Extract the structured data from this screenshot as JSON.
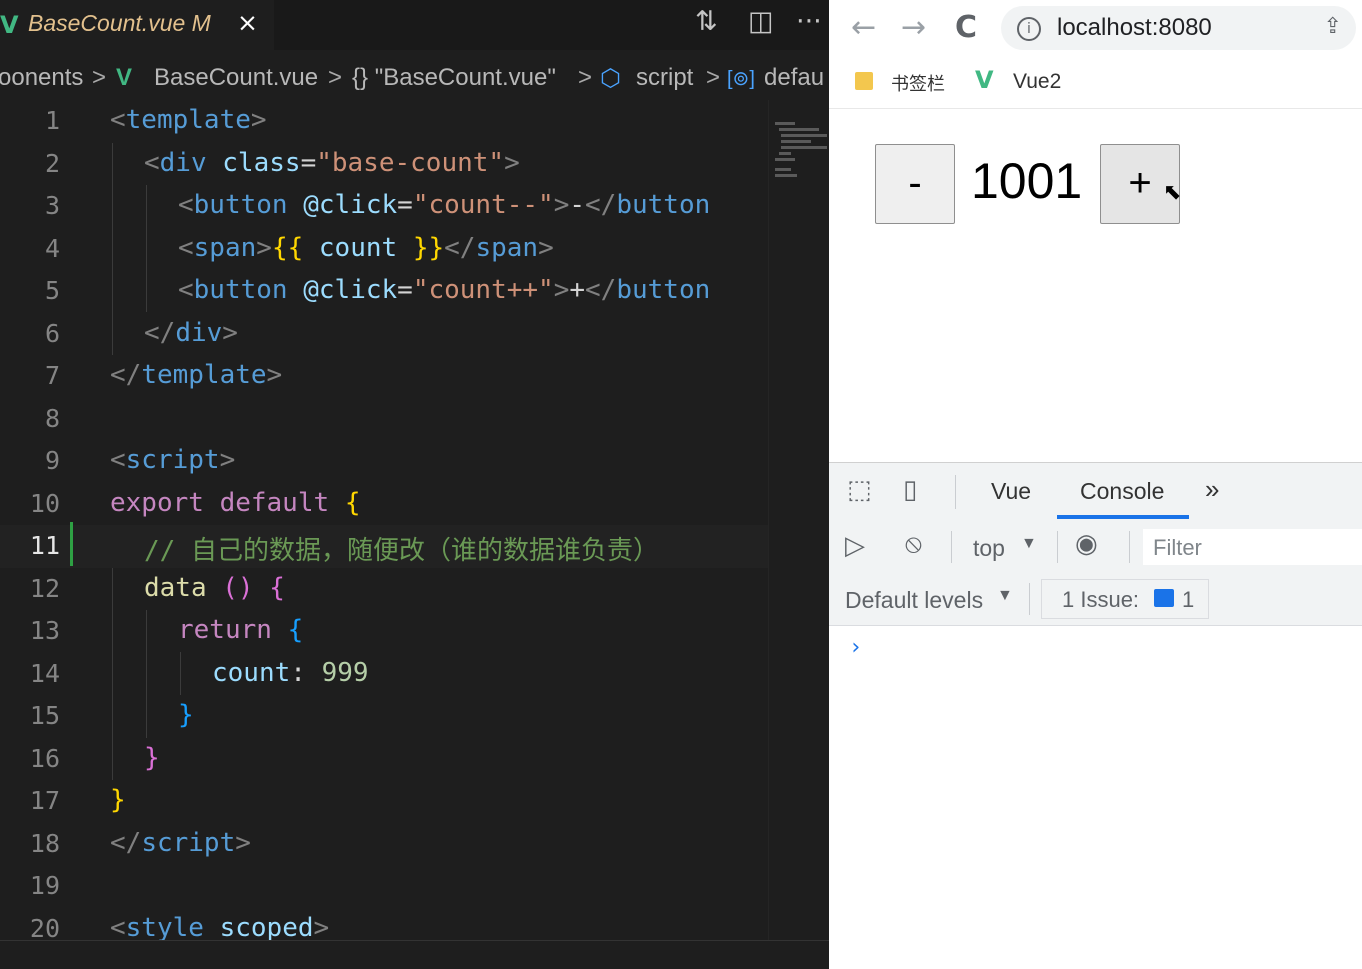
{
  "editor": {
    "tab": {
      "title": "BaseCount.vue  M",
      "close": "×",
      "logo": "V"
    },
    "toolbar_icons": [
      "compare-changes-icon",
      "split-editor-icon",
      "more-actions-icon"
    ],
    "toolbar_glyphs": {
      "compare": "⇅",
      "split": "◫",
      "more": "···"
    },
    "breadcrumb": {
      "items": [
        "oonents",
        "BaseCount.vue",
        "{} \"BaseCount.vue\"",
        "script",
        "defau"
      ],
      "separator": ">",
      "vue_logo": "V",
      "script_glyph": "⬡",
      "default_glyph": "[⊚]"
    },
    "active_line": 11,
    "line_numbers": [
      "1",
      "2",
      "3",
      "4",
      "5",
      "6",
      "7",
      "8",
      "9",
      "10",
      "11",
      "12",
      "13",
      "14",
      "15",
      "16",
      "17",
      "18",
      "19",
      "20"
    ],
    "code": {
      "l1": {
        "lt": "<",
        "tag": "template",
        "gt": ">"
      },
      "l2": {
        "lt": "<",
        "tag": "div",
        "attr": "class",
        "eq": "=",
        "val": "\"base-count\"",
        "gt": ">"
      },
      "l3": {
        "lt": "<",
        "tag": "button",
        "attr": "@click",
        "eq": "=",
        "val": "\"count--\"",
        "gt": ">",
        "text": "-",
        "close": "</",
        "ctag": "button"
      },
      "l4": {
        "lt": "<",
        "tag": "span",
        "gt": ">",
        "open": "{{",
        "expr": " count ",
        "end": "}}",
        "close": "</",
        "ctag": "span",
        "cgt": ">"
      },
      "l5": {
        "lt": "<",
        "tag": "button",
        "attr": "@click",
        "eq": "=",
        "val": "\"count++\"",
        "gt": ">",
        "text": "+",
        "close": "</",
        "ctag": "button"
      },
      "l6": {
        "close": "</",
        "tag": "div",
        "gt": ">"
      },
      "l7": {
        "close": "</",
        "tag": "template",
        "gt": ">"
      },
      "l9": {
        "lt": "<",
        "tag": "script",
        "gt": ">"
      },
      "l10": {
        "kw": "export default",
        "brace": "{"
      },
      "l11": {
        "comment": "// 自己的数据，随便改（谁的数据谁负责）"
      },
      "l12": {
        "name": "data",
        "paren": "()",
        "brace": "{"
      },
      "l13": {
        "kw": "return",
        "brace": "{"
      },
      "l14": {
        "key": "count",
        "colon": ":",
        "num": "999"
      },
      "l15": {
        "brace": "}"
      },
      "l16": {
        "brace": "}"
      },
      "l17": {
        "brace": "}"
      },
      "l18": {
        "close": "</",
        "tag": "script",
        "gt": ">"
      },
      "l20": {
        "lt": "<",
        "tag": "style",
        "attr": "scoped",
        "gt": ">"
      }
    }
  },
  "browser": {
    "url": "localhost:8080",
    "nav": {
      "back": "←",
      "forward": "→",
      "reload": "C"
    },
    "info_icon": "i",
    "share_icon": "⇪",
    "bookmarks": [
      {
        "label": "书签栏",
        "icon": "folder-icon"
      },
      {
        "label": "Vue2",
        "icon": "vue-logo-icon",
        "glyph": "V"
      }
    ],
    "app": {
      "minus_label": "-",
      "count": "1001",
      "plus_label": "+"
    },
    "cursor_glyph": "⬉"
  },
  "devtools": {
    "tabs": [
      "Vue",
      "Console"
    ],
    "active_tab": "Console",
    "more_tabs": "»",
    "icons": {
      "inspect": "⬚",
      "device": "▯",
      "sidebar": "▷",
      "clear": "⦸",
      "eye": "◉"
    },
    "context": "top",
    "dropdown_arrow": "▼",
    "filter_placeholder": "Filter",
    "levels": "Default levels",
    "issues_label": "1 Issue:",
    "issues_count": "1",
    "prompt": "›"
  },
  "colors": {
    "vue_green": "#41b883",
    "accent_blue": "#1a73e8",
    "modified_tab": "#e2c08d",
    "editor_bg": "#1e1e1e"
  }
}
